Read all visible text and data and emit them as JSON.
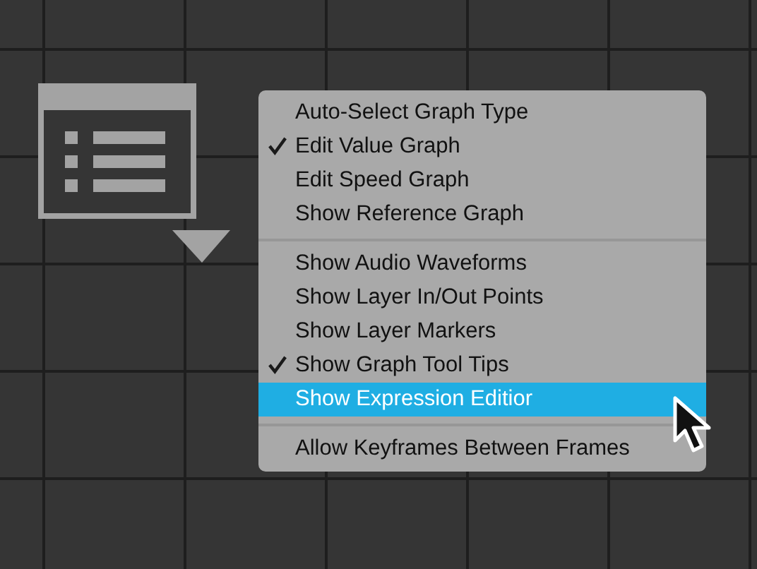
{
  "menu": {
    "sections": [
      {
        "items": [
          {
            "label": "Auto-Select Graph Type",
            "checked": false,
            "selected": false
          },
          {
            "label": "Edit Value Graph",
            "checked": true,
            "selected": false
          },
          {
            "label": "Edit Speed Graph",
            "checked": false,
            "selected": false
          },
          {
            "label": "Show Reference Graph",
            "checked": false,
            "selected": false
          }
        ]
      },
      {
        "items": [
          {
            "label": "Show Audio Waveforms",
            "checked": false,
            "selected": false
          },
          {
            "label": "Show Layer In/Out Points",
            "checked": false,
            "selected": false
          },
          {
            "label": "Show Layer Markers",
            "checked": false,
            "selected": false
          },
          {
            "label": "Show Graph Tool Tips",
            "checked": true,
            "selected": false
          },
          {
            "label": "Show Expression Editior",
            "checked": false,
            "selected": true
          }
        ]
      },
      {
        "items": [
          {
            "label": "Allow Keyframes Between Frames",
            "checked": false,
            "selected": false
          }
        ]
      }
    ]
  }
}
